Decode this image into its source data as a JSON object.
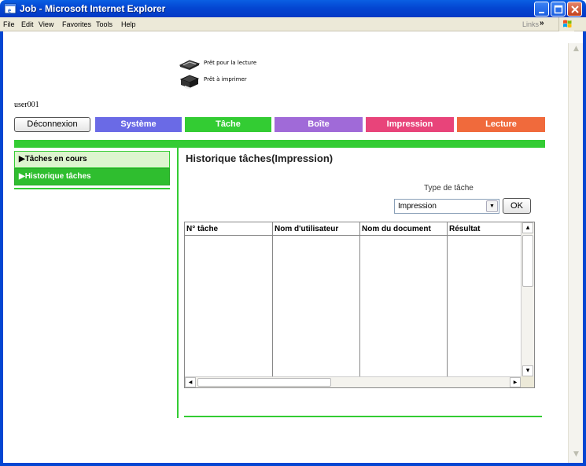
{
  "window": {
    "title": "Job - Microsoft Internet Explorer"
  },
  "menu": {
    "items": [
      "File",
      "Edit",
      "View",
      "Favorites",
      "Tools",
      "Help"
    ],
    "links_label": "Links",
    "links_chevron": "»"
  },
  "status": {
    "scanner_text": "Prêt pour la lecture",
    "printer_text": "Prêt à imprimer"
  },
  "user": {
    "name": "user001"
  },
  "nav": {
    "logout_label": "Déconnexion",
    "tabs": [
      {
        "label": "Système",
        "color": "#6a6ae6"
      },
      {
        "label": "Tâche",
        "color": "#33cc33"
      },
      {
        "label": "Boîte",
        "color": "#a06ad8"
      },
      {
        "label": "Impression",
        "color": "#e8447a"
      },
      {
        "label": "Lecture",
        "color": "#f06a3c"
      }
    ]
  },
  "sidebar": {
    "items": [
      {
        "label": "▶Tâches en cours",
        "active": false
      },
      {
        "label": "▶Historique tâches",
        "active": true
      }
    ]
  },
  "main": {
    "title": "Historique tâches(Impression)",
    "type_label": "Type de tâche",
    "type_selected": "Impression",
    "ok_label": "OK",
    "table": {
      "columns": [
        "N° tâche",
        "Nom d'utilisateur",
        "Nom du document",
        "Résultat"
      ],
      "rows": []
    }
  },
  "colors": {
    "accent_green": "#33cc33",
    "titlebar_blue": "#0446d2"
  }
}
